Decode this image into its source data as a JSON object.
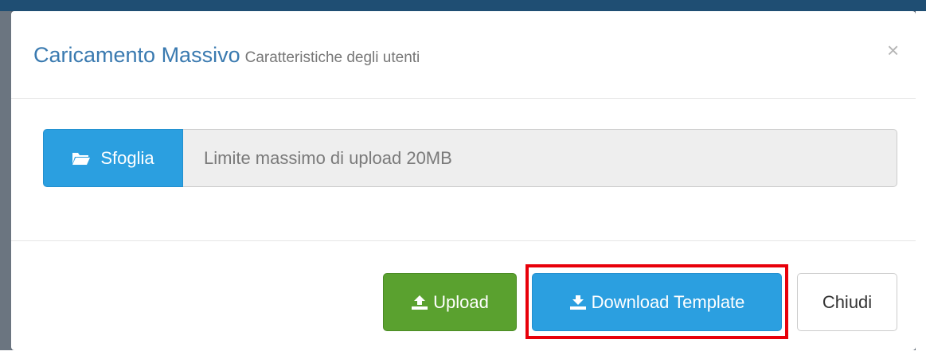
{
  "modal": {
    "title": "Caricamento Massivo",
    "subtitle": "Caratteristiche degli utenti",
    "close_symbol": "×"
  },
  "file_upload": {
    "browse_label": "Sfoglia",
    "browse_icon": "folder-open-icon",
    "placeholder": "Limite massimo di upload 20MB"
  },
  "footer": {
    "upload_label": "Upload",
    "upload_icon": "upload-icon",
    "download_label": "Download Template",
    "download_icon": "download-icon",
    "close_label": "Chiudi"
  },
  "colors": {
    "title": "#3a7ab0",
    "primary": "#2b9fe0",
    "success": "#5aa12f",
    "highlight": "#e8000a"
  }
}
